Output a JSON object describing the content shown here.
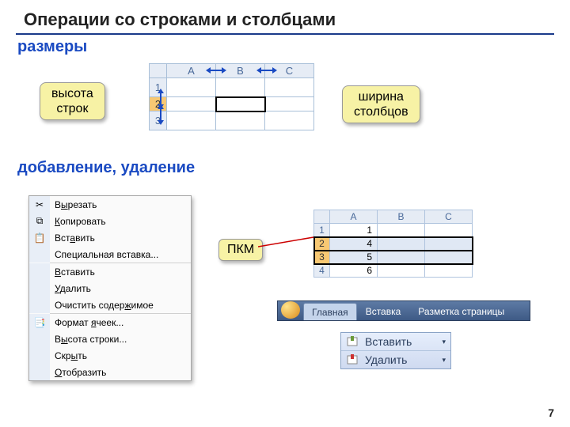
{
  "title": "Операции со строками и столбцами",
  "sections": {
    "sizes": "размеры",
    "add_del": "добавление, удаление"
  },
  "callouts": {
    "row_height": "высота\nстрок",
    "col_width": "ширина\nстолбцов",
    "rmb": "ПКМ"
  },
  "grid1": {
    "cols": [
      "A",
      "B",
      "C"
    ],
    "rows": [
      "1",
      "2",
      "3"
    ]
  },
  "context_menu": [
    {
      "icon": "cut",
      "label_pre": "В",
      "u": "ы",
      "label_post": "резать"
    },
    {
      "icon": "copy",
      "label_pre": "",
      "u": "К",
      "label_post": "опировать"
    },
    {
      "icon": "paste",
      "label_pre": "Вст",
      "u": "а",
      "label_post": "вить"
    },
    {
      "icon": "",
      "label_pre": "Специальная вставка...",
      "u": "",
      "label_post": ""
    },
    {
      "sep": true
    },
    {
      "icon": "",
      "label_pre": "",
      "u": "В",
      "label_post": "ставить"
    },
    {
      "icon": "",
      "label_pre": "",
      "u": "У",
      "label_post": "далить"
    },
    {
      "icon": "",
      "label_pre": "Очистить содер",
      "u": "ж",
      "label_post": "имое"
    },
    {
      "sep": true
    },
    {
      "icon": "format",
      "label_pre": "Формат ",
      "u": "я",
      "label_post": "чеек..."
    },
    {
      "icon": "",
      "label_pre": "В",
      "u": "ы",
      "label_post": "сота строки..."
    },
    {
      "icon": "",
      "label_pre": "Скр",
      "u": "ы",
      "label_post": "ть"
    },
    {
      "icon": "",
      "label_pre": "",
      "u": "О",
      "label_post": "тобразить"
    }
  ],
  "grid2": {
    "cols": [
      "A",
      "B",
      "C"
    ],
    "rows": [
      {
        "h": "1",
        "a": "1",
        "b": "",
        "c": ""
      },
      {
        "h": "2",
        "a": "4",
        "b": "",
        "c": "",
        "sel": true
      },
      {
        "h": "3",
        "a": "5",
        "b": "",
        "c": "",
        "sel": true
      },
      {
        "h": "4",
        "a": "6",
        "b": "",
        "c": ""
      }
    ]
  },
  "ribbon": {
    "tabs": [
      "Главная",
      "Вставка",
      "Разметка страницы"
    ]
  },
  "buttons": {
    "insert": "Вставить",
    "delete": "Удалить"
  },
  "page": "7"
}
